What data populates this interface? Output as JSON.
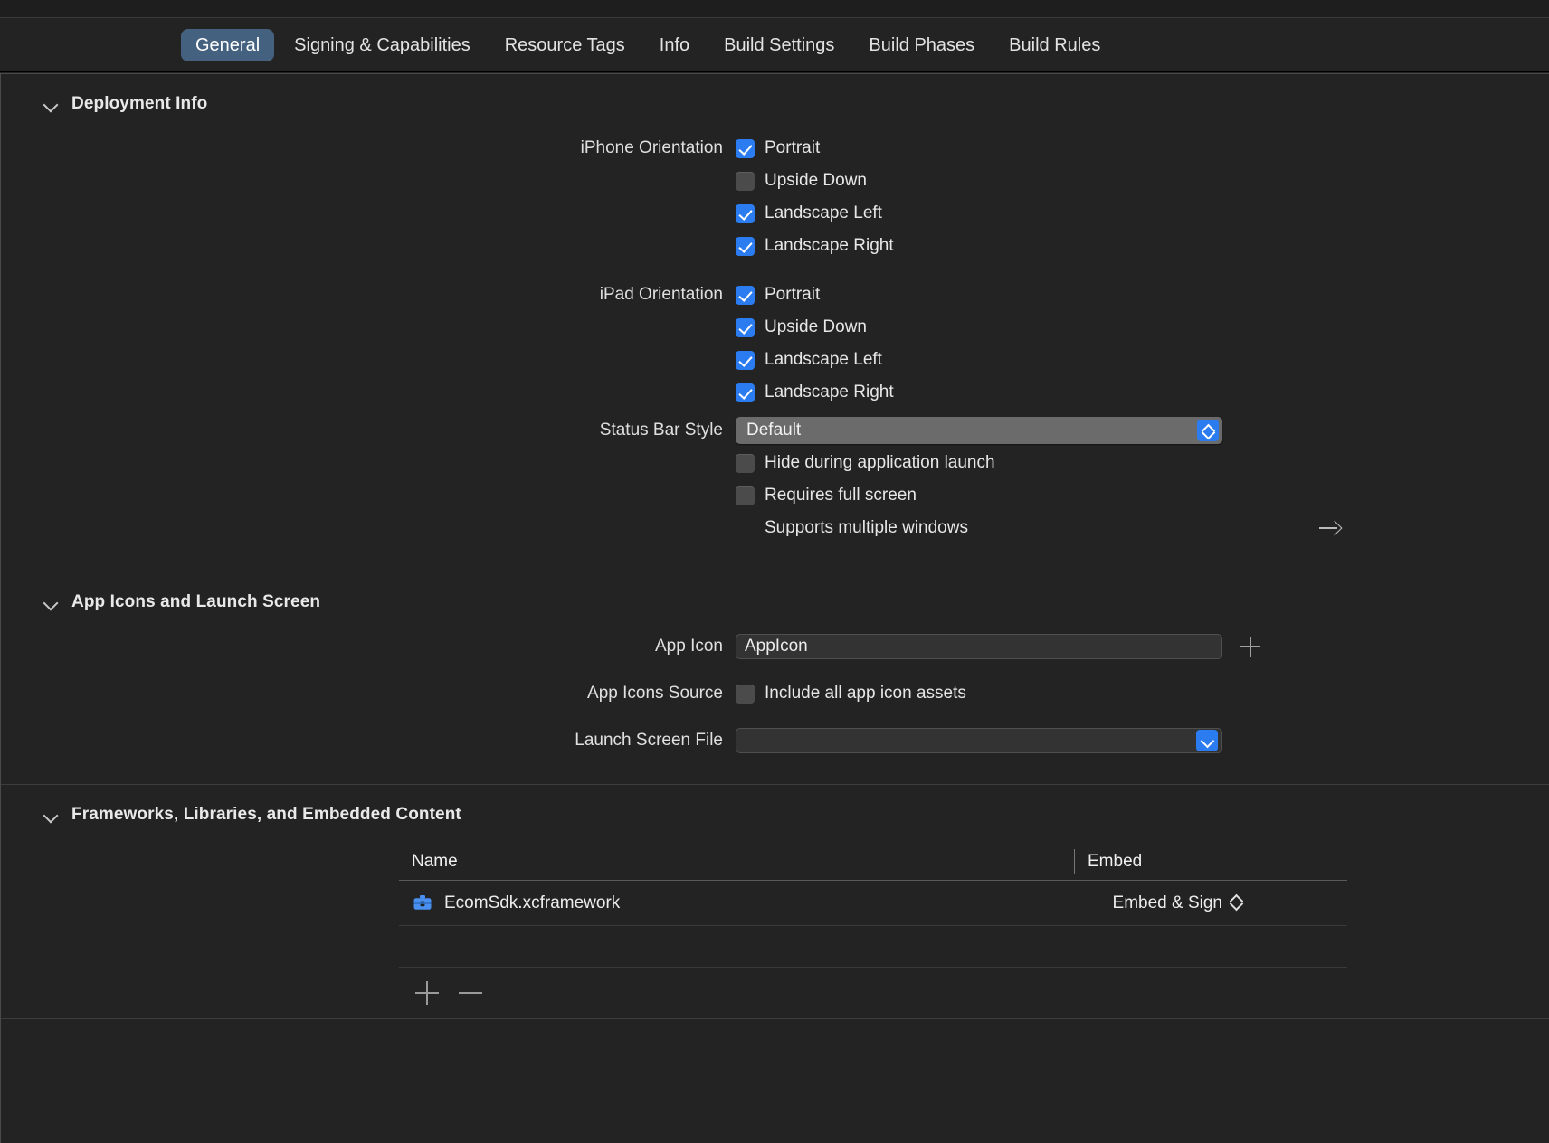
{
  "tabs": [
    {
      "label": "General",
      "active": true
    },
    {
      "label": "Signing & Capabilities",
      "active": false
    },
    {
      "label": "Resource Tags",
      "active": false
    },
    {
      "label": "Info",
      "active": false
    },
    {
      "label": "Build Settings",
      "active": false
    },
    {
      "label": "Build Phases",
      "active": false
    },
    {
      "label": "Build Rules",
      "active": false
    }
  ],
  "colors": {
    "accent_blue": "#2b7cf0",
    "tab_active_bg": "#44617f",
    "window_bg": "#232323",
    "popup_bg": "#6b6b6b",
    "textfield_bg": "#333333"
  },
  "deployment_info": {
    "title": "Deployment Info",
    "iphone_orientation": {
      "label": "iPhone Orientation",
      "options": [
        {
          "label": "Portrait",
          "checked": true
        },
        {
          "label": "Upside Down",
          "checked": false
        },
        {
          "label": "Landscape Left",
          "checked": true
        },
        {
          "label": "Landscape Right",
          "checked": true
        }
      ]
    },
    "ipad_orientation": {
      "label": "iPad Orientation",
      "options": [
        {
          "label": "Portrait",
          "checked": true
        },
        {
          "label": "Upside Down",
          "checked": true
        },
        {
          "label": "Landscape Left",
          "checked": true
        },
        {
          "label": "Landscape Right",
          "checked": true
        }
      ]
    },
    "status_bar_style": {
      "label": "Status Bar Style",
      "value": "Default"
    },
    "status_bar_options": [
      {
        "label": "Hide during application launch",
        "checked": false
      },
      {
        "label": "Requires full screen",
        "checked": false
      }
    ],
    "supports_multiple_windows": {
      "label": "Supports multiple windows"
    }
  },
  "app_icons": {
    "title": "App Icons and Launch Screen",
    "app_icon": {
      "label": "App Icon",
      "value": "AppIcon"
    },
    "app_icons_source": {
      "label": "App Icons Source",
      "option_label": "Include all app icon assets",
      "checked": false
    },
    "launch_screen_file": {
      "label": "Launch Screen File",
      "value": ""
    }
  },
  "frameworks": {
    "title": "Frameworks, Libraries, and Embedded Content",
    "columns": {
      "name": "Name",
      "embed": "Embed"
    },
    "rows": [
      {
        "name": "EcomSdk.xcframework",
        "embed": "Embed & Sign"
      }
    ]
  }
}
